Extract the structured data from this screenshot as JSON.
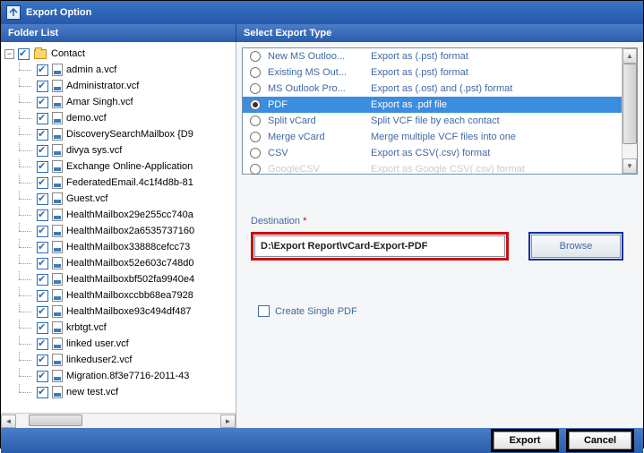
{
  "window": {
    "title": "Export Option"
  },
  "headers": {
    "left": "Folder List",
    "right": "Select Export Type"
  },
  "tree": {
    "root": {
      "label": "Contact"
    },
    "items": [
      "admin a.vcf",
      "Administrator.vcf",
      "Amar Singh.vcf",
      "demo.vcf",
      "DiscoverySearchMailbox {D9",
      "divya sys.vcf",
      "Exchange Online-Application",
      "FederatedEmail.4c1f4d8b-81",
      "Guest.vcf",
      "HealthMailbox29e255cc740a",
      "HealthMailbox2a6535737160",
      "HealthMailbox33888cefcc73",
      "HealthMailbox52e603c748d0",
      "HealthMailboxbf502fa9940e4",
      "HealthMailboxccbb68ea7928",
      "HealthMailboxe93c494df487",
      "krbtgt.vcf",
      "linked user.vcf",
      "linkeduser2.vcf",
      "Migration.8f3e7716-2011-43",
      "new test.vcf"
    ]
  },
  "exportTypes": [
    {
      "name": "New MS Outloo...",
      "desc": "Export as (.pst) format",
      "selected": false
    },
    {
      "name": "Existing MS Out...",
      "desc": "Export as (.pst) format",
      "selected": false
    },
    {
      "name": "MS Outlook Pro...",
      "desc": "Export as (.ost) and (.pst) format",
      "selected": false
    },
    {
      "name": "PDF",
      "desc": "Export as .pdf file",
      "selected": true
    },
    {
      "name": "Split vCard",
      "desc": "Split VCF file by each contact",
      "selected": false
    },
    {
      "name": "Merge vCard",
      "desc": "Merge multiple VCF files into one",
      "selected": false
    },
    {
      "name": "CSV",
      "desc": "Export as CSV(.csv) format",
      "selected": false
    },
    {
      "name": "GoogleCSV",
      "desc": "Export as Google CSV(.csv) format",
      "selected": false
    }
  ],
  "destination": {
    "label": "Destination",
    "value": "D:\\Export Report\\vCard-Export-PDF",
    "browse": "Browse"
  },
  "options": {
    "createSinglePdf": "Create Single PDF"
  },
  "footer": {
    "export": "Export",
    "cancel": "Cancel"
  }
}
